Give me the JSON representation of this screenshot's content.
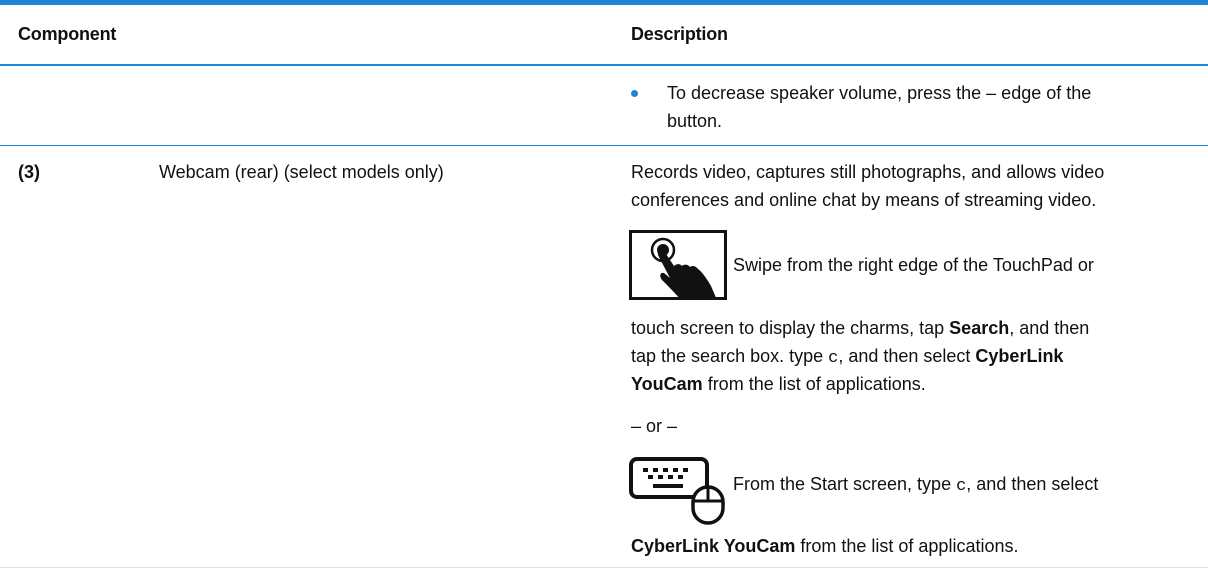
{
  "header": {
    "component_label": "Component",
    "description_label": "Description"
  },
  "rows": [
    {
      "description_bullet": {
        "line1": "To decrease speaker volume, press the – edge of the",
        "line2": "button."
      }
    },
    {
      "number": "(3)",
      "component": "Webcam (rear) (select models only)",
      "desc_line1": "Records video, captures still photographs, and allows video",
      "desc_line2": "conferences and online chat by means of streaming video.",
      "touch_icon": "touch-swipe-icon",
      "touch_text": "Swipe from the right edge of the TouchPad or",
      "touch_cont": {
        "l1_a": "touch screen to display the charms, tap ",
        "l1_b": "Search",
        "l1_c": ", and then",
        "l2_a": "tap the search box. type ",
        "l2_b": "c",
        "l2_c": ", and then select ",
        "l2_d": "CyberLink",
        "l3_a": "YouCam",
        "l3_b": " from the list of applications."
      },
      "or_text": "– or –",
      "keyboard_icon": "keyboard-mouse-icon",
      "keyboard_text": {
        "a": "From the Start screen, type ",
        "b": "c",
        "c": ", and then select"
      },
      "keyboard_cont": {
        "a": "CyberLink YouCam",
        "b": " from the list of applications."
      }
    }
  ],
  "colors": {
    "accent": "#1e86d6",
    "text": "#111111",
    "divider": "#dfe3e8"
  }
}
